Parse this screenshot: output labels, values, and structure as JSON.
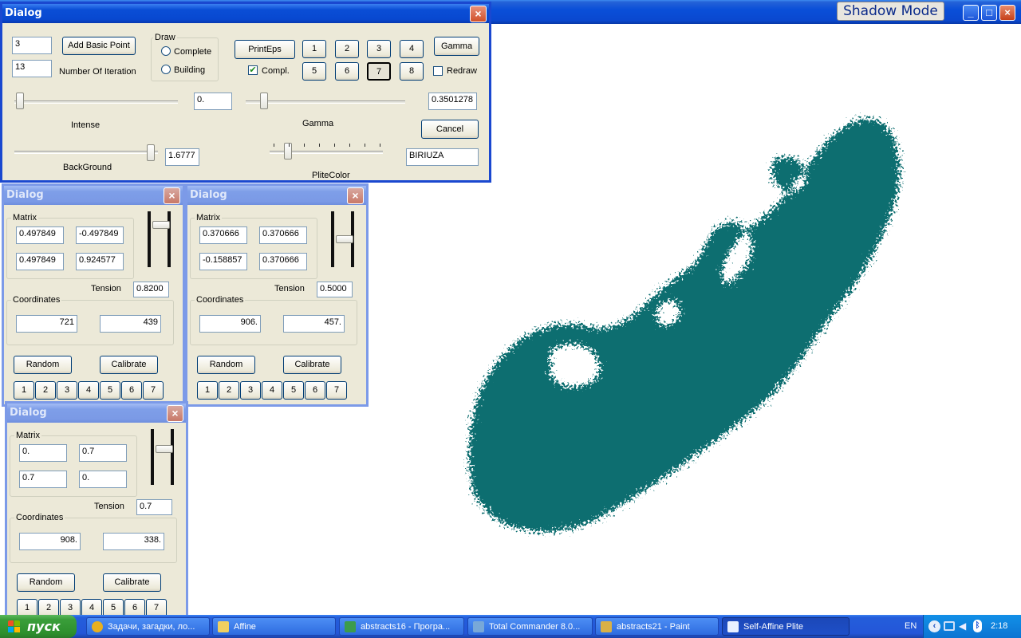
{
  "app": {
    "shadow_mode_label": "Shadow Mode",
    "minimize_glyph": "_",
    "maximize_glyph": "□",
    "close_glyph": "×"
  },
  "main_dialog": {
    "title": "Dialog",
    "basic_point_value": "3",
    "iterations_value": "13",
    "add_basic_point_label": "Add Basic Point",
    "number_of_iteration_label": "Number Of Iteration",
    "draw_group_label": "Draw",
    "radio_complete_label": "Complete",
    "radio_building_label": "Building",
    "printeps_label": "PrintEps",
    "compl_label": "Compl.",
    "compl_checked": true,
    "num_buttons": [
      "1",
      "2",
      "3",
      "4",
      "5",
      "6",
      "7",
      "8"
    ],
    "num_pressed": "7",
    "gamma_button_label": "Gamma",
    "redraw_label": "Redraw",
    "intense_value": "0.",
    "intense_label": "Intense",
    "gamma_value": "0.3501278",
    "gamma_label": "Gamma",
    "cancel_label": "Cancel",
    "background_value": "1.6777",
    "background_label": "BackGround",
    "plite_color_label": "PliteColor",
    "plite_color_value": "BIRIUZA"
  },
  "matrix_dialogs": [
    {
      "title": "Dialog",
      "matrix_label": "Matrix",
      "m11": "0.497849",
      "m12": "-0.497849",
      "m21": "0.497849",
      "m22": "0.924577",
      "tension_label": "Tension",
      "tension_value": "0.8200",
      "coordinates_label": "Coordinates",
      "coord_x": "721",
      "coord_y": "439",
      "random_label": "Random",
      "calibrate_label": "Calibrate",
      "num_buttons": [
        "1",
        "2",
        "3",
        "4",
        "5",
        "6",
        "7"
      ]
    },
    {
      "title": "Dialog",
      "matrix_label": "Matrix",
      "m11": "0.370666",
      "m12": "0.370666",
      "m21": "-0.158857",
      "m22": "0.370666",
      "tension_label": "Tension",
      "tension_value": "0.5000",
      "coordinates_label": "Coordinates",
      "coord_x": "906.",
      "coord_y": "457.",
      "random_label": "Random",
      "calibrate_label": "Calibrate",
      "num_buttons": [
        "1",
        "2",
        "3",
        "4",
        "5",
        "6",
        "7"
      ]
    },
    {
      "title": "Dialog",
      "matrix_label": "Matrix",
      "m11": "0.",
      "m12": "0.7",
      "m21": "0.7",
      "m22": "0.",
      "tension_label": "Tension",
      "tension_value": "0.7",
      "coordinates_label": "Coordinates",
      "coord_x": "908.",
      "coord_y": "338.",
      "random_label": "Random",
      "calibrate_label": "Calibrate",
      "num_buttons": [
        "1",
        "2",
        "3",
        "4",
        "5",
        "6",
        "7"
      ]
    }
  ],
  "fractal": {
    "color": "#0f6e70",
    "highlight": "#3bb0ae"
  },
  "taskbar": {
    "start_label": "пуск",
    "tasks": [
      {
        "label": "Задачи, загадки, ло...",
        "icon": "chrome-icon"
      },
      {
        "label": "Affine",
        "icon": "folder-icon"
      },
      {
        "label": "abstracts16 - Програ...",
        "icon": "image-viewer-icon"
      },
      {
        "label": "Total Commander 8.0...",
        "icon": "total-commander-icon"
      },
      {
        "label": "abstracts21 - Paint",
        "icon": "paint-icon"
      },
      {
        "label": "Self-Affine Plite",
        "icon": "app-window-icon"
      }
    ],
    "language": "EN",
    "clock": "2:18"
  }
}
